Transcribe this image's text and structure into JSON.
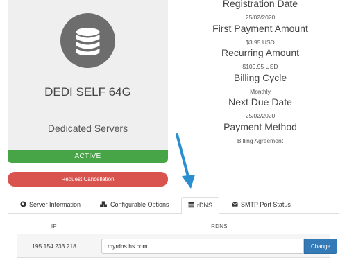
{
  "product": {
    "name": "DEDI SELF 64G",
    "group": "Dedicated Servers",
    "status": "ACTIVE",
    "icon": "database-icon",
    "colors": {
      "card_bg": "#efefef",
      "icon_bg": "#6d6d6d",
      "status_bg": "#47a447"
    }
  },
  "actions": {
    "cancel_label": "Request Cancellation",
    "cancel_color": "#d9534f"
  },
  "info": {
    "registration_label": "Registration Date",
    "registration_value": "25/02/2020",
    "first_payment_label": "First Payment Amount",
    "first_payment_value": "$3.95 USD",
    "recurring_label": "Recurring Amount",
    "recurring_value": "$109.95 USD",
    "billing_cycle_label": "Billing Cycle",
    "billing_cycle_value": "Monthly",
    "next_due_label": "Next Due Date",
    "next_due_value": "25/02/2020",
    "payment_method_label": "Payment Method",
    "payment_method_value": "Billing Agreement"
  },
  "tabs": [
    {
      "label": "Server Information",
      "icon": "globe-icon"
    },
    {
      "label": "Configurable Options",
      "icon": "cubes-icon"
    },
    {
      "label": "rDNS",
      "icon": "server-icon",
      "active": true
    },
    {
      "label": "SMTP Port Status",
      "icon": "envelope-icon"
    }
  ],
  "rdns": {
    "columns": {
      "ip": "IP",
      "rdns": "RDNS"
    },
    "rows": [
      {
        "ip": "195.154.233.218",
        "value": "myrdns.hs.com",
        "button": "Change"
      }
    ],
    "button_color": "#337ab7"
  },
  "annotation": {
    "arrow_color": "#2a8fd0",
    "arrow_icon": "pointer-arrow-icon"
  }
}
